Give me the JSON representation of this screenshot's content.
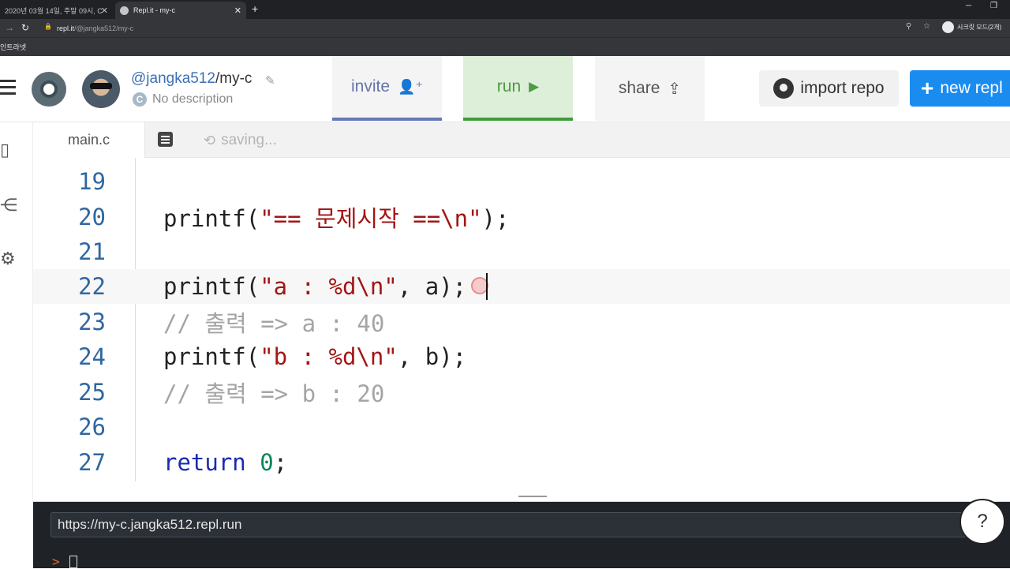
{
  "browser": {
    "tabs": [
      {
        "title": "2020년 03월 14일, 주말 09시, C"
      },
      {
        "title": "Repl.it - my-c"
      }
    ],
    "url_host": "repl.it",
    "url_path": "/@jangka512/my-c",
    "bookmark": "인트라넷",
    "incognito_label": "시크릿 모드(2개)"
  },
  "header": {
    "username": "@jangka512",
    "repl_name": "/my-c",
    "description": "No description",
    "language_letter": "C",
    "invite_label": "invite",
    "run_label": "run",
    "share_label": "share",
    "import_label": "import repo",
    "new_repl_label": "new repl"
  },
  "editor": {
    "file_tab": "main.c",
    "status": "saving...",
    "lines": [
      {
        "no": "19"
      },
      {
        "no": "20"
      },
      {
        "no": "21"
      },
      {
        "no": "22"
      },
      {
        "no": "23"
      },
      {
        "no": "24"
      },
      {
        "no": "25"
      },
      {
        "no": "26"
      },
      {
        "no": "27"
      }
    ],
    "code": {
      "l20_fn": "printf(",
      "l20_str": "\"== 문제시작 ==\\n\"",
      "l20_end": ");",
      "l22_fn": "printf(",
      "l22_str": "\"a : %d\\n\"",
      "l22_rest": ", a);",
      "l23_comment": "// 출력 => a : 40",
      "l24_fn": "printf(",
      "l24_str": "\"b : %d\\n\"",
      "l24_rest": ", b);",
      "l25_comment": "// 출력 => b : 20",
      "l27_kw": "return",
      "l27_num": "0",
      "l27_end": ";"
    }
  },
  "console": {
    "url": "https://my-c.jangka512.repl.run",
    "prompt": ">"
  },
  "help_label": "?",
  "colors": {
    "accent_blue": "#1a8cf0",
    "run_green": "#3f9b3a",
    "invite_purple": "#6679b4"
  }
}
